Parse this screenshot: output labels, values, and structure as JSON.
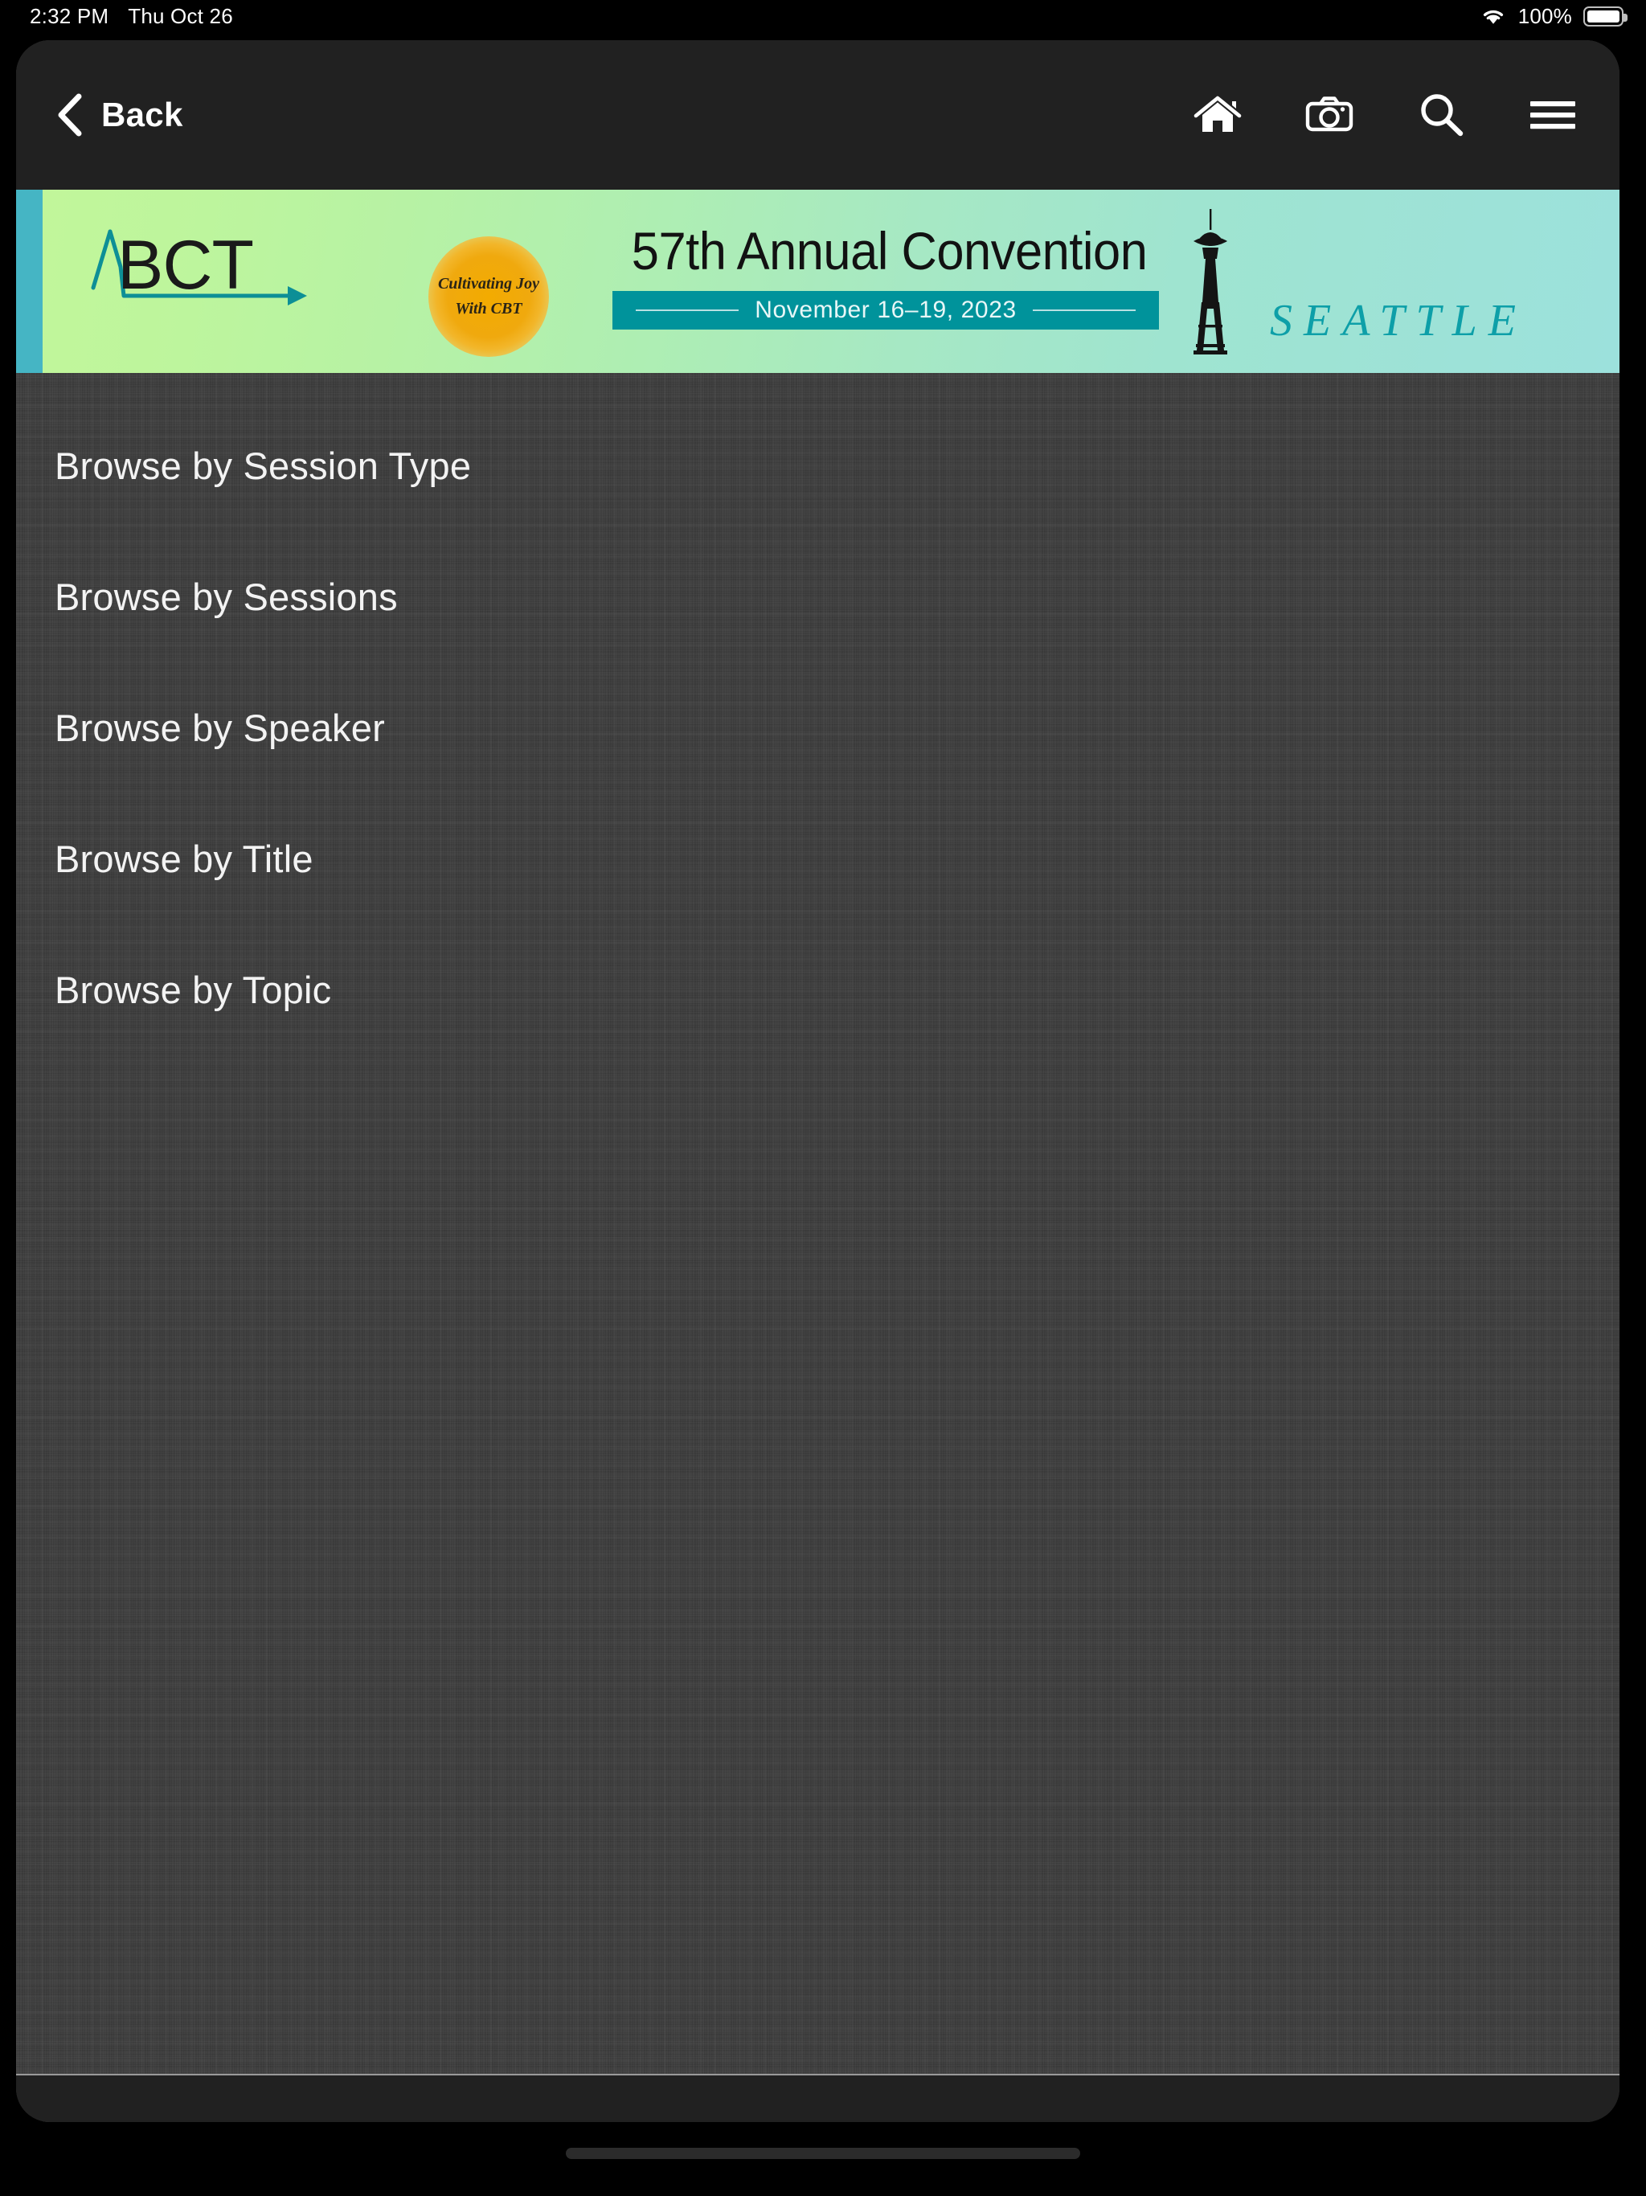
{
  "status_bar": {
    "time": "2:32 PM",
    "date": "Thu Oct 26",
    "wifi_icon": "wifi-icon",
    "battery_percent": "100%",
    "battery_icon": "battery-icon"
  },
  "nav_bar": {
    "back_label": "Back",
    "back_icon": "chevron-left-icon",
    "actions": [
      {
        "name": "home-icon",
        "label": "Home"
      },
      {
        "name": "camera-icon",
        "label": "Camera"
      },
      {
        "name": "search-icon",
        "label": "Search"
      },
      {
        "name": "hamburger-icon",
        "label": "Menu"
      }
    ]
  },
  "banner": {
    "logo_text": "ABCT",
    "tagline_line1": "Cultivating Joy",
    "tagline_line2": "With CBT",
    "convention_title": "57th Annual Convention",
    "convention_dates": "November 16–19, 2023",
    "city": "SEATTLE",
    "landmark_icon": "space-needle-icon",
    "colors": {
      "stripe": "#45b5c4",
      "gradient_start": "#c2f69a",
      "gradient_end": "#9ce1dc",
      "date_band": "#00939b",
      "city_text": "#0d9fa8",
      "sun": "#f0a90e",
      "logo_accent": "#0d8f96"
    }
  },
  "menu": {
    "items": [
      {
        "label": "Browse by Session Type",
        "name": "browse-by-session-type"
      },
      {
        "label": "Browse by Sessions",
        "name": "browse-by-sessions"
      },
      {
        "label": "Browse by Speaker",
        "name": "browse-by-speaker"
      },
      {
        "label": "Browse by Title",
        "name": "browse-by-title"
      },
      {
        "label": "Browse by Topic",
        "name": "browse-by-topic"
      }
    ]
  }
}
